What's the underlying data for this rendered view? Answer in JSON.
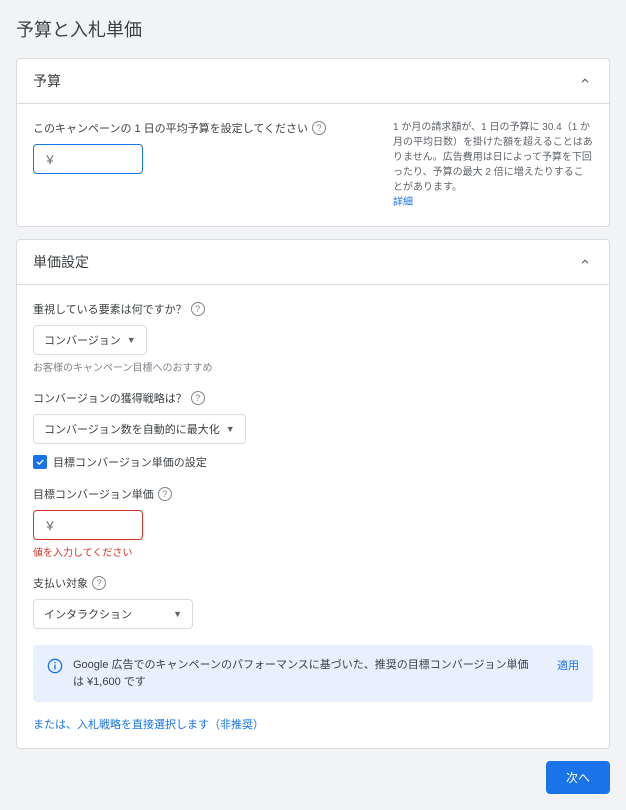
{
  "page_title": "予算と入札単価",
  "budget": {
    "title": "予算",
    "label": "このキャンペーンの 1 日の平均予算を設定してください",
    "currency": "￥",
    "note": "1 か月の請求額が、1 日の予算に 30.4（1 か月の平均日数）を掛けた額を超えることはありません。広告費用は日によって予算を下回ったり、予算の最大 2 倍に増えたりすることがあります。",
    "details_link": "詳細"
  },
  "bidding": {
    "title": "単価設定",
    "focus_label": "重視している要素は何ですか？",
    "focus_value": "コンバージョン",
    "focus_helper": "お客様のキャンペーン目標へのおすすめ",
    "strategy_label": "コンバージョンの獲得戦略は？",
    "strategy_value": "コンバージョン数を自動的に最大化",
    "checkbox_label": "目標コンバージョン単価の設定",
    "target_cpa_label": "目標コンバージョン単価",
    "currency": "￥",
    "target_cpa_error": "値を入力してください",
    "pay_for_label": "支払い対象",
    "pay_for_value": "インタラクション",
    "info_banner": "Google 広告でのキャンペーンのパフォーマンスに基づいた、推奨の目標コンバージョン単価は ¥1,600 です",
    "apply_label": "適用",
    "footer_link": "または、入札戦略を直接選択します（非推奨）"
  },
  "next_button": "次へ"
}
